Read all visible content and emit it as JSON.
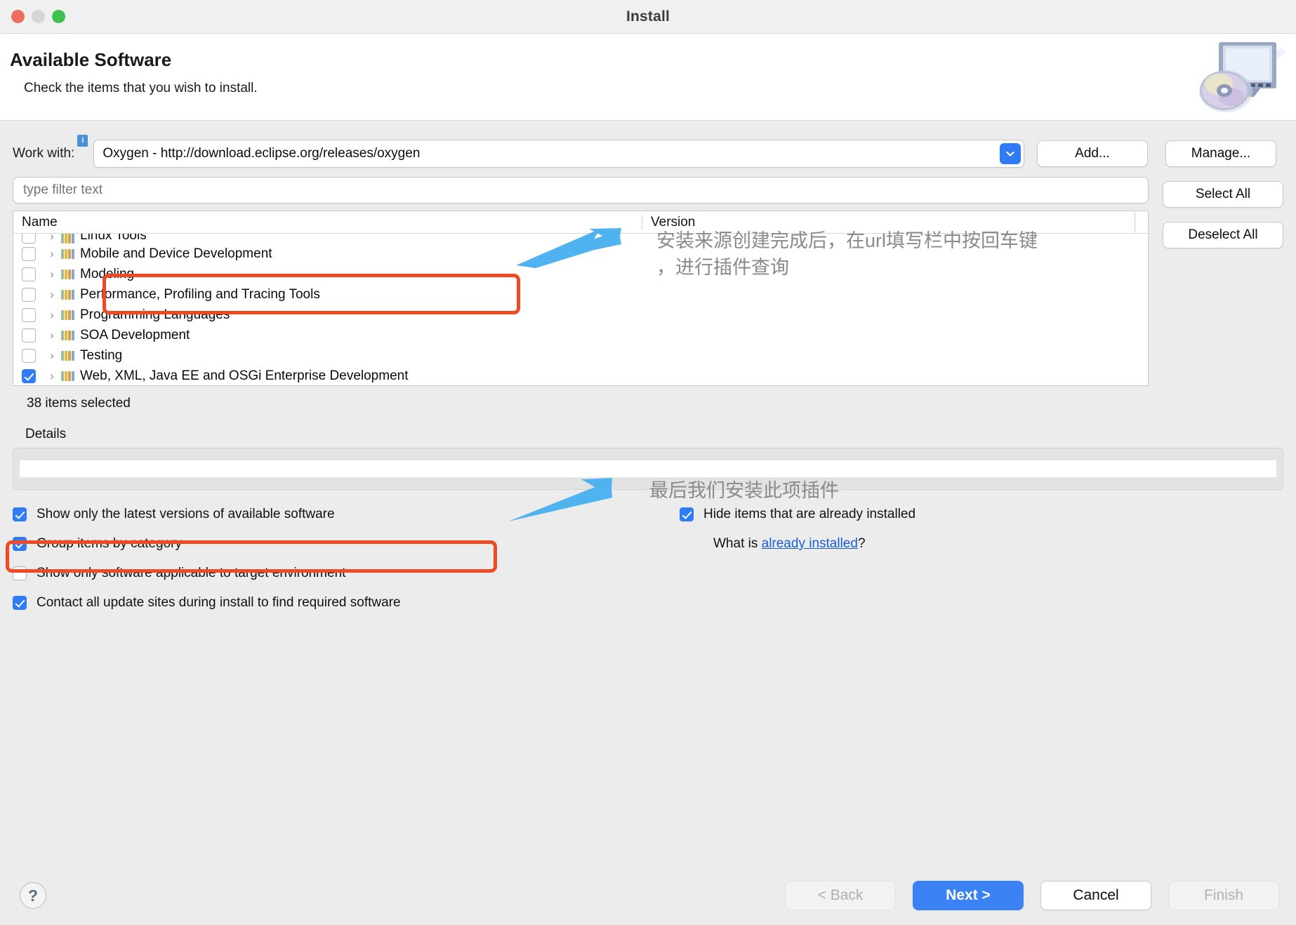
{
  "window": {
    "title": "Install",
    "traffic_lights": [
      "close-light",
      "minimize-light",
      "maximize-light"
    ]
  },
  "header": {
    "title": "Available Software",
    "subtitle": "Check the items that you wish to install.",
    "icon": "monitor-cd-icon"
  },
  "workwith": {
    "label": "Work with:",
    "info_badge": "i",
    "value": "Oxygen - http://download.eclipse.org/releases/oxygen",
    "dropdown_icon": "chevron-down-icon",
    "add_label": "Add...",
    "manage_label": "Manage..."
  },
  "filter": {
    "placeholder": "type filter text",
    "value": ""
  },
  "side_buttons": {
    "select_all": "Select All",
    "deselect_all": "Deselect All"
  },
  "tree": {
    "columns": [
      "Name",
      "Version"
    ],
    "rows": [
      {
        "name": "Linux Tools",
        "checked": false,
        "expandable": true,
        "clipped": true
      },
      {
        "name": "Mobile and Device Development",
        "checked": false,
        "expandable": true,
        "clipped": false
      },
      {
        "name": "Modeling",
        "checked": false,
        "expandable": true,
        "clipped": false
      },
      {
        "name": "Performance, Profiling and Tracing Tools",
        "checked": false,
        "expandable": true,
        "clipped": false
      },
      {
        "name": "Programming Languages",
        "checked": false,
        "expandable": true,
        "clipped": false
      },
      {
        "name": "SOA Development",
        "checked": false,
        "expandable": true,
        "clipped": false
      },
      {
        "name": "Testing",
        "checked": false,
        "expandable": true,
        "clipped": false
      },
      {
        "name": "Web, XML, Java EE and OSGi Enterprise Development",
        "checked": true,
        "expandable": true,
        "clipped": false
      }
    ],
    "status": "38 items selected"
  },
  "details": {
    "label": "Details",
    "value": ""
  },
  "options": {
    "left": [
      {
        "label": "Show only the latest versions of available software",
        "checked": true
      },
      {
        "label": "Group items by category",
        "checked": true
      },
      {
        "label": "Show only software applicable to target environment",
        "checked": false
      },
      {
        "label": "Contact all update sites during install to find required software",
        "checked": true
      }
    ],
    "right": [
      {
        "label": "Hide items that are already installed",
        "checked": true
      }
    ],
    "whatis_prefix": "What is ",
    "whatis_link": "already installed",
    "whatis_suffix": "?"
  },
  "footer": {
    "help": "?",
    "back": "< Back",
    "next": "Next >",
    "cancel": "Cancel",
    "finish": "Finish"
  },
  "annotations": {
    "arrow_color": "#4eb3ef",
    "box_color": "#ef4a23",
    "text_color": "#8a8a8a",
    "note1": "安装来源创建完成后，在url填写栏中按回车键\n，进行插件查询",
    "note2": "最后我们安装此项插件"
  }
}
